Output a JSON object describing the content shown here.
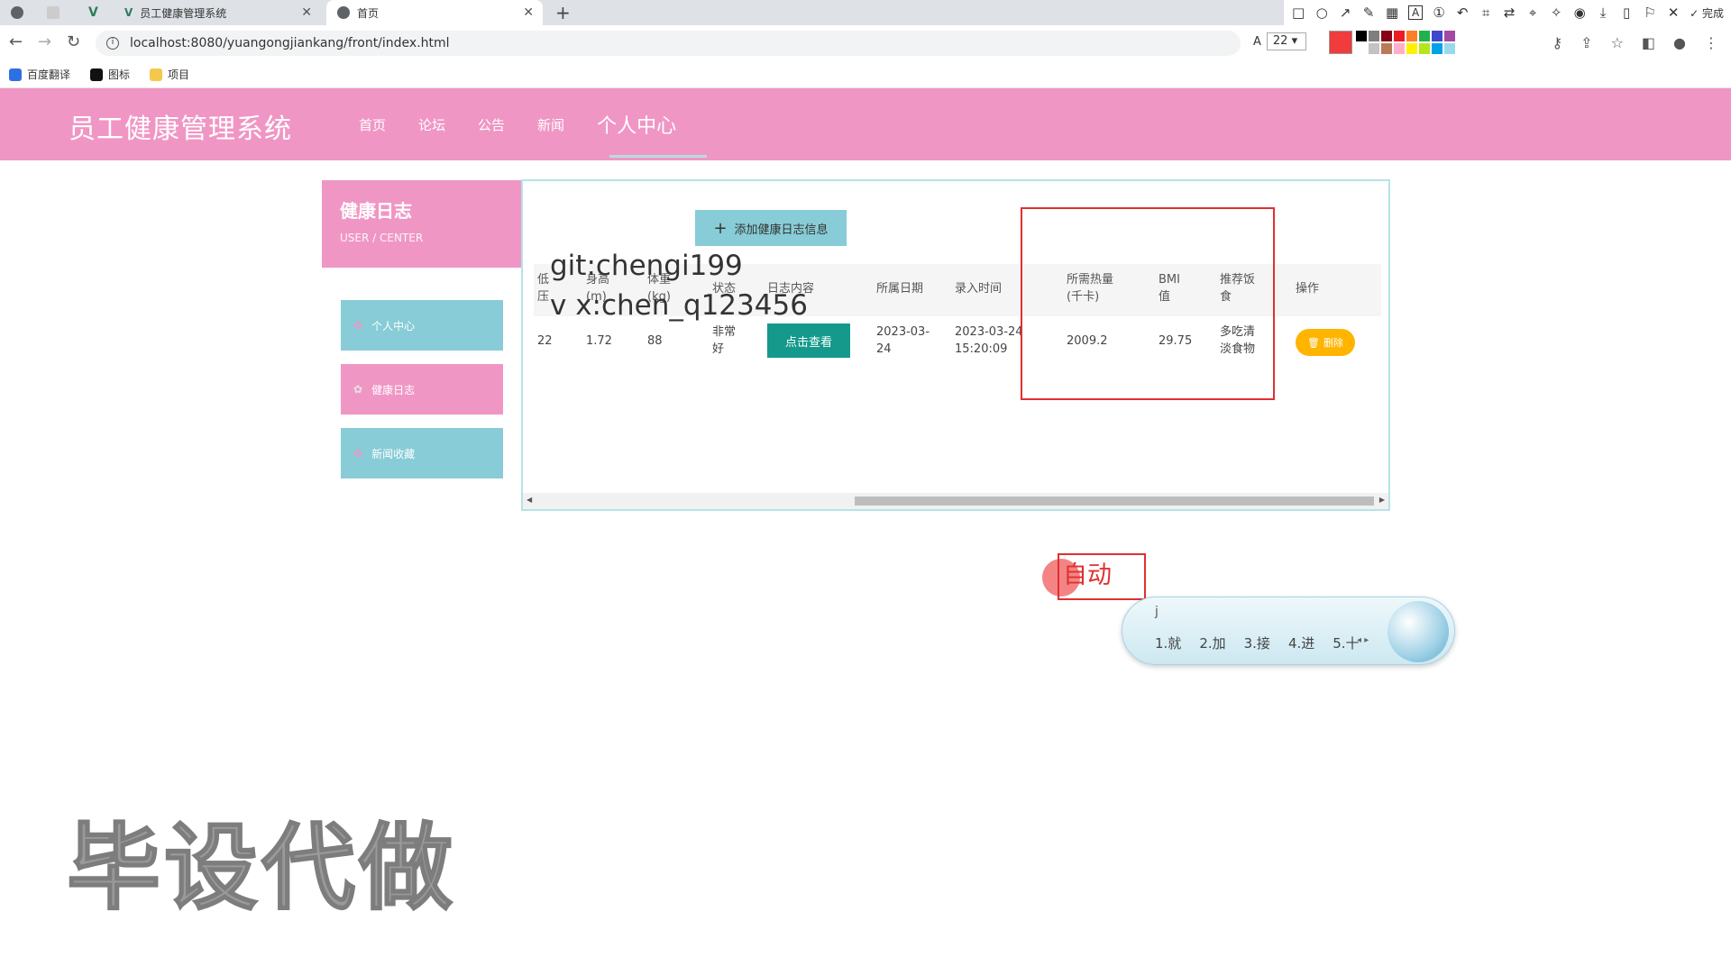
{
  "browser": {
    "tabs": [
      {
        "label": ""
      },
      {
        "label": ""
      },
      {
        "label": ""
      },
      {
        "label": "员工健康管理系统"
      },
      {
        "label": "首页"
      }
    ],
    "url": "localhost:8080/yuangongjiankang/front/index.html",
    "font_size_value": "22",
    "done_label": "完成",
    "bookmarks": [
      "百度翻译",
      "图标",
      "项目"
    ],
    "palette_colors": [
      "#000000",
      "#7f7f7f",
      "#880015",
      "#ed1c24",
      "#ff7f27",
      "#22b14c",
      "#3f48cc",
      "#a349a4",
      "#ffffff",
      "#c3c3c3",
      "#b97a57",
      "#ffaec9",
      "#fff200",
      "#b5e61d",
      "#00a2e8",
      "#99d9ea"
    ],
    "accent_color": "#f03c3c"
  },
  "site": {
    "title": "员工健康管理系统",
    "nav": [
      "首页",
      "论坛",
      "公告",
      "新闻",
      "个人中心"
    ],
    "header_color": "#f096c5"
  },
  "sidebar": {
    "title": "健康日志",
    "subtitle": "USER / CENTER",
    "items": [
      "个人中心",
      "健康日志",
      "新闻收藏"
    ]
  },
  "main": {
    "add_button": "添加健康日志信息",
    "columns": [
      "低压",
      "身高(m)",
      "体重(kg)",
      "状态",
      "日志内容",
      "所属日期",
      "录入时间",
      "所需热量(千卡)",
      "BMI值",
      "推荐饭食",
      "操作"
    ],
    "row": {
      "low_pressure": "22",
      "height": "1.72",
      "weight": "88",
      "status": "非常好",
      "view_button": "点击查看",
      "date": "2023-03-24",
      "entry_time": "2023-03-24 15:20:09",
      "calories": "2009.2",
      "bmi": "29.75",
      "meal": "多吃清淡食物",
      "delete_button": "删除"
    }
  },
  "overlay": {
    "watermark_line1": "git:chengi199",
    "watermark_line2": "v x:chen_q123456",
    "ime_text": "自动",
    "ime_pinyin": "j",
    "ime_candidates": [
      "1.就",
      "2.加",
      "3.接",
      "4.进",
      "5.十"
    ],
    "big_watermark": "毕设代做"
  }
}
